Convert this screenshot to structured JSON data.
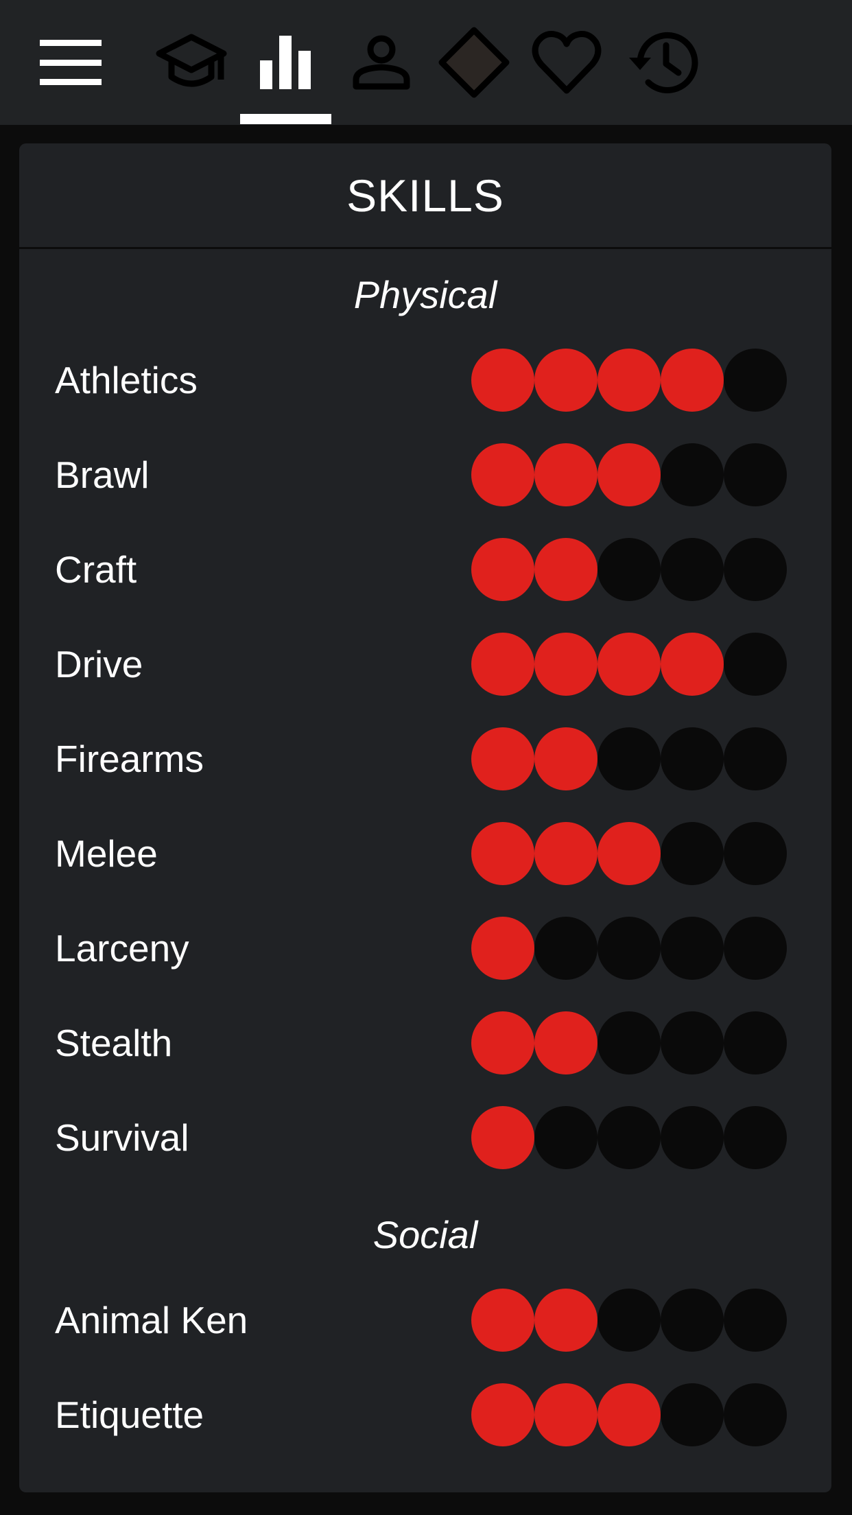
{
  "nav": {
    "menu_icon": "hamburger-menu-icon",
    "tabs": [
      {
        "icon": "graduation-cap-icon",
        "active": false
      },
      {
        "icon": "bar-chart-icon",
        "active": true
      },
      {
        "icon": "person-icon",
        "active": false
      },
      {
        "icon": "diamond-icon",
        "active": false
      },
      {
        "icon": "heart-icon",
        "active": false
      },
      {
        "icon": "history-icon",
        "active": false
      }
    ]
  },
  "panel": {
    "title": "SKILLS",
    "max_dots": 5,
    "sections": [
      {
        "title": "Physical",
        "skills": [
          {
            "name": "Athletics",
            "value": 4
          },
          {
            "name": "Brawl",
            "value": 3
          },
          {
            "name": "Craft",
            "value": 2
          },
          {
            "name": "Drive",
            "value": 4
          },
          {
            "name": "Firearms",
            "value": 2
          },
          {
            "name": "Melee",
            "value": 3
          },
          {
            "name": "Larceny",
            "value": 1
          },
          {
            "name": "Stealth",
            "value": 2
          },
          {
            "name": "Survival",
            "value": 1
          }
        ]
      },
      {
        "title": "Social",
        "skills": [
          {
            "name": "Animal Ken",
            "value": 2
          },
          {
            "name": "Etiquette",
            "value": 3
          }
        ]
      }
    ]
  },
  "colors": {
    "topbar": "#212325",
    "background": "#0c0c0c",
    "panel": "#202225",
    "dot_filled": "#e0211d",
    "dot_empty": "#0a0a0a"
  }
}
